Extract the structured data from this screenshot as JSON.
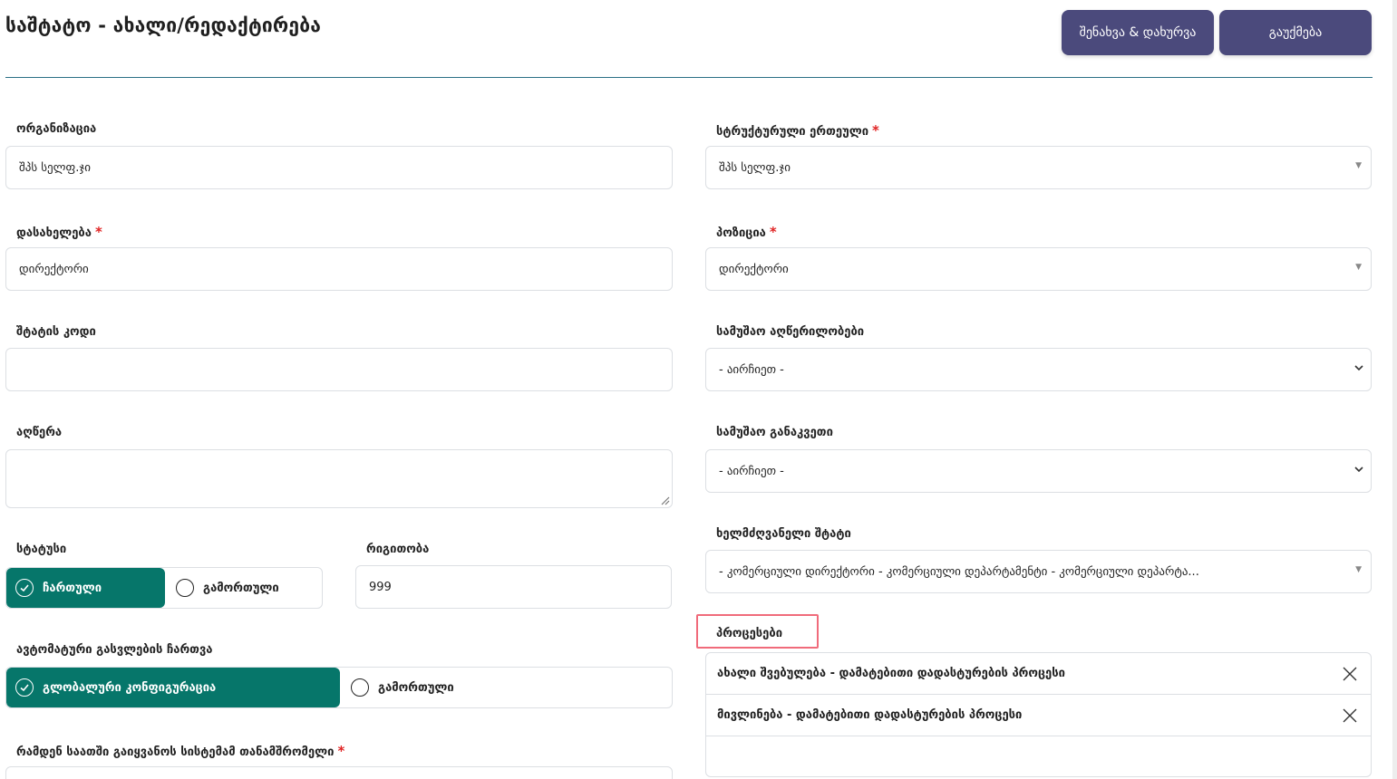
{
  "header": {
    "title": "საშტატო - ახალი/რედაქტირება",
    "save_label": "შენახვა & დახურვა",
    "cancel_label": "გაუქმება"
  },
  "left": {
    "organization": {
      "label": "ორგანიზაცია",
      "value": "შპს სელფ.ჯი"
    },
    "name": {
      "label": "დასახელება",
      "required_mark": "*",
      "value": "დირექტორი"
    },
    "staff_code": {
      "label": "შტატის კოდი",
      "value": ""
    },
    "description": {
      "label": "აღწერა",
      "value": ""
    },
    "status": {
      "label": "სტატუსი",
      "on_label": "ჩართული",
      "off_label": "გამორთული",
      "selected": "ჩართული"
    },
    "order": {
      "label": "რიგითობა",
      "value": "999"
    },
    "auto_checkout": {
      "label": "ავტომატური გასვლების ჩართვა",
      "on_label": "გლობალური კონფიგურაცია",
      "off_label": "გამორთული",
      "selected": "გლობალური კონფიგურაცია"
    },
    "hours": {
      "label": "რამდენ საათში გაიყვანოს სისტემამ თანამშრომელი",
      "required_mark": "*"
    }
  },
  "right": {
    "structural_unit": {
      "label": "სტრუქტურული ერთეული",
      "required_mark": "*",
      "value": "შპს სელფ.ჯი"
    },
    "position": {
      "label": "პოზიცია",
      "required_mark": "*",
      "value": "დირექტორი"
    },
    "work_descriptions": {
      "label": "სამუშაო აღწერილობები",
      "value": "- აირჩიეთ -"
    },
    "work_schedule": {
      "label": "სამუშაო განაკვეთი",
      "value": "- აირჩიეთ -"
    },
    "manager_staff": {
      "label": "ხელმძღვანელი შტატი",
      "value": "- კომერციული დირექტორი - კომერციული დეპარტამენტი - კომერციული დეპარტა..."
    },
    "processes": {
      "label": "პროცესები",
      "items": [
        "ახალი შვებულება - დამატებითი დადასტურების პროცესი",
        "მივლინება - დამატებითი დადასტურების პროცესი"
      ]
    }
  },
  "colors": {
    "primary_button": "#4b4a7c",
    "toggle_on": "#06766a",
    "required": "#e02424",
    "highlight": "#f06b7b"
  }
}
